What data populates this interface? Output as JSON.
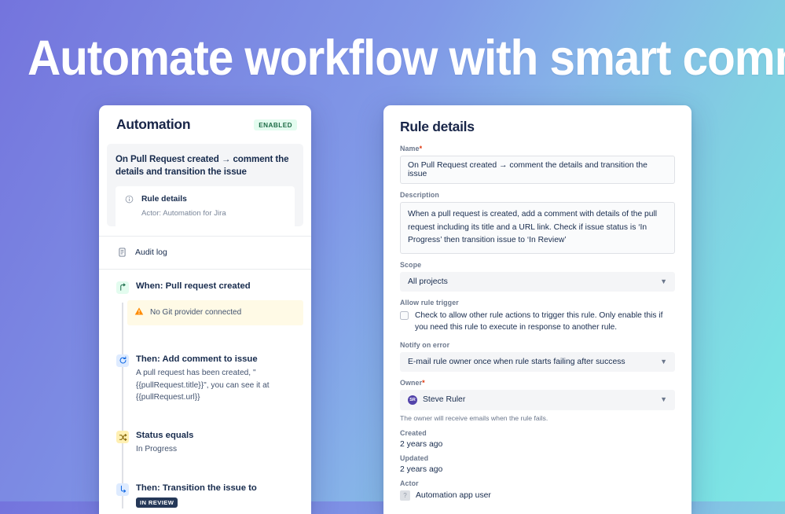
{
  "headline": "Automate workflow with smart commits",
  "colors": {
    "gradient_start": "#7474dd",
    "gradient_mid": "#86b3e8",
    "gradient_end": "#7fe7e6",
    "enabled_badge_bg": "#e3fcef",
    "enabled_badge_text": "#1c6b45",
    "trigger_icon_bg": "#e3fcef",
    "action_icon_bg": "#deebff",
    "condition_icon_bg": "#fff0b3",
    "warning_bg": "#fffae6",
    "review_badge_bg": "#253858",
    "required_asterisk": "#de350b",
    "owner_avatar": "#5243aa"
  },
  "left_panel": {
    "title": "Automation",
    "status_badge": "ENABLED",
    "rule_card": {
      "title": "On Pull Request created → comment the details and transition the issue",
      "detail_label": "Rule details",
      "actor_text": "Actor: Automation for Jira"
    },
    "audit_log_label": "Audit log",
    "nodes": [
      {
        "icon": "trigger-branch-icon",
        "icon_glyph": "⤵",
        "title": "When: Pull request created",
        "sub": "",
        "warning": "No Git provider connected",
        "warning_icon": "warning-triangle-icon"
      },
      {
        "icon": "action-refresh-icon",
        "icon_glyph": "↻",
        "title": "Then: Add comment to issue",
        "sub": "A pull request has been created, \" {{pullRequest.title}}\", you can see it at {{pullRequest.url}}",
        "warning": "",
        "warning_icon": ""
      },
      {
        "icon": "condition-compare-icon",
        "icon_glyph": "⤫",
        "title": "Status equals",
        "sub": "In Progress",
        "warning": "",
        "warning_icon": ""
      },
      {
        "icon": "transition-arrow-icon",
        "icon_glyph": "↳",
        "title": "Then: Transition the issue to",
        "sub": "",
        "badge": "IN REVIEW",
        "warning": "",
        "warning_icon": ""
      }
    ]
  },
  "right_panel": {
    "title": "Rule details",
    "name": {
      "label": "Name",
      "required": true,
      "value": "On Pull Request created → comment the details and transition the issue"
    },
    "description": {
      "label": "Description",
      "value": "When a pull request is created, add a comment with details of the pull request including its title and a URL link. Check if issue status is ‘In Progress’ then transition issue to ‘In Review’"
    },
    "scope": {
      "label": "Scope",
      "value": "All projects"
    },
    "allow_rule_trigger": {
      "label": "Allow rule trigger",
      "checked": false,
      "text": "Check to allow other rule actions to trigger this rule. Only enable this if you need this rule to execute in response to another rule."
    },
    "notify_on_error": {
      "label": "Notify on error",
      "value": "E-mail rule owner once when rule starts failing after success"
    },
    "owner": {
      "label": "Owner",
      "required": true,
      "value": "Steve Ruler",
      "avatar_initials": "SR",
      "helper": "The owner will receive emails when the rule fails."
    },
    "created": {
      "label": "Created",
      "value": "2 years ago"
    },
    "updated": {
      "label": "Updated",
      "value": "2 years ago"
    },
    "actor": {
      "label": "Actor",
      "value": "Automation app user"
    }
  }
}
